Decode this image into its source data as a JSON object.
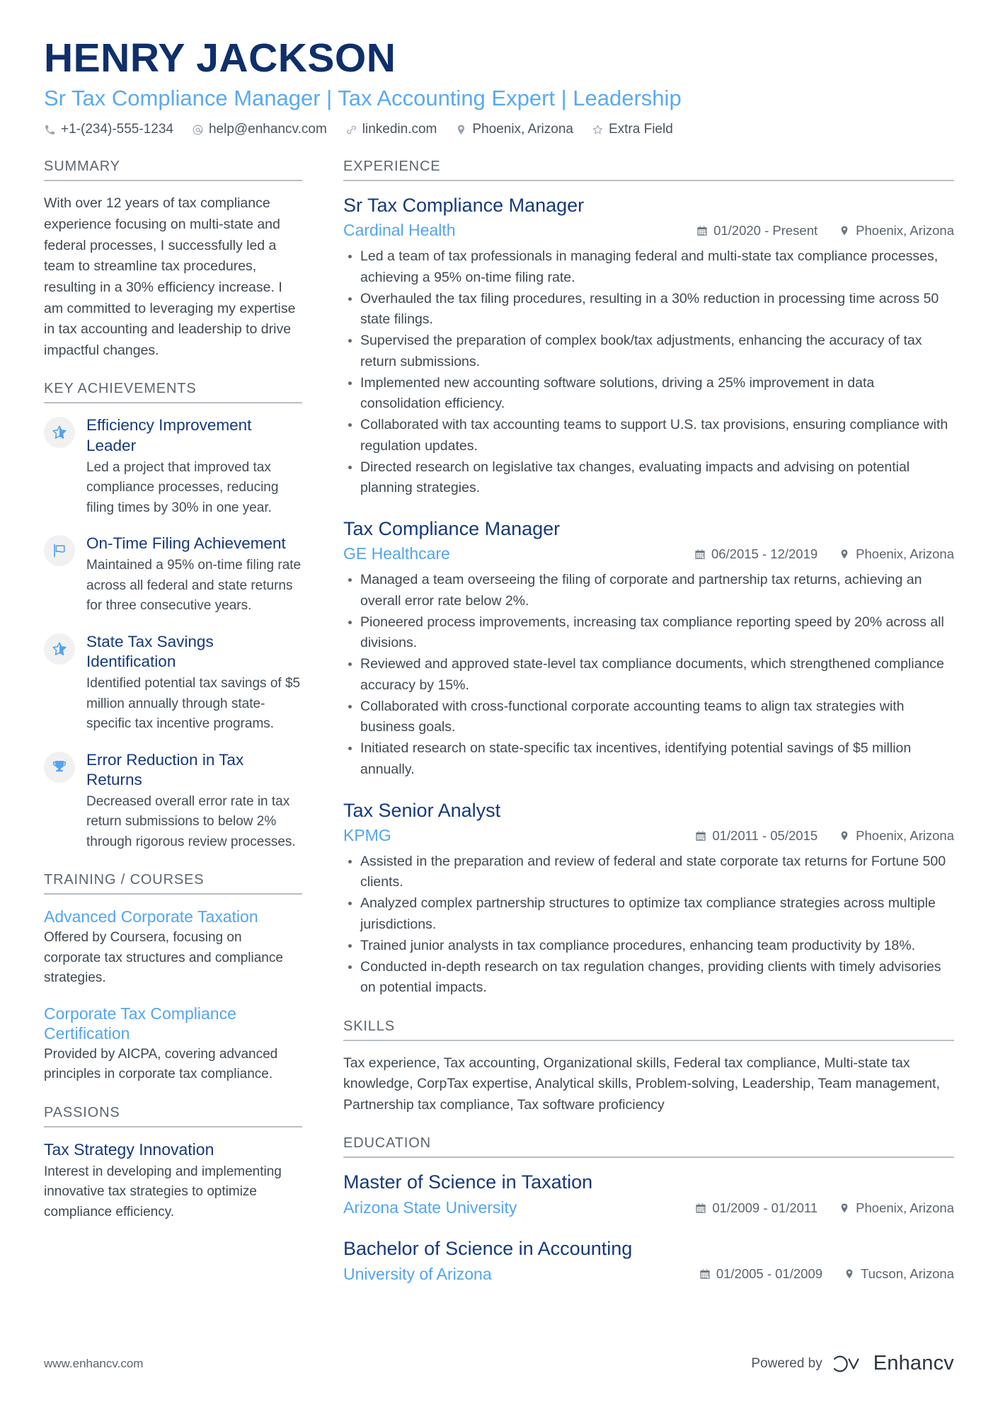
{
  "header": {
    "name": "HENRY JACKSON",
    "title": "Sr Tax Compliance Manager | Tax Accounting Expert | Leadership",
    "contacts": [
      {
        "icon": "phone-icon",
        "text": "+1-(234)-555-1234"
      },
      {
        "icon": "email-icon",
        "text": "help@enhancv.com"
      },
      {
        "icon": "link-icon",
        "text": "linkedin.com"
      },
      {
        "icon": "location-pin-icon",
        "text": "Phoenix, Arizona"
      },
      {
        "icon": "star-icon",
        "text": "Extra Field"
      }
    ]
  },
  "left": {
    "summary": {
      "heading": "SUMMARY",
      "text": "With over 12 years of tax compliance experience focusing on multi-state and federal processes, I successfully led a team to streamline tax procedures, resulting in a 30% efficiency increase. I am committed to leveraging my expertise in tax accounting and leadership to drive impactful changes."
    },
    "key_achievements": {
      "heading": "KEY ACHIEVEMENTS",
      "items": [
        {
          "icon": "half-star-icon",
          "title": "Efficiency Improvement Leader",
          "description": "Led a project that improved tax compliance processes, reducing filing times by 30% in one year."
        },
        {
          "icon": "flag-icon",
          "title": "On-Time Filing Achievement",
          "description": "Maintained a 95% on-time filing rate across all federal and state returns for three consecutive years."
        },
        {
          "icon": "half-star-icon",
          "title": "State Tax Savings Identification",
          "description": "Identified potential tax savings of $5 million annually through state-specific tax incentive programs."
        },
        {
          "icon": "trophy-icon",
          "title": "Error Reduction in Tax Returns",
          "description": "Decreased overall error rate in tax return submissions to below 2% through rigorous review processes."
        }
      ]
    },
    "training": {
      "heading": "TRAINING / COURSES",
      "items": [
        {
          "title": "Advanced Corporate Taxation",
          "description": "Offered by Coursera, focusing on corporate tax structures and compliance strategies."
        },
        {
          "title": "Corporate Tax Compliance Certification",
          "description": "Provided by AICPA, covering advanced principles in corporate tax compliance."
        }
      ]
    },
    "passions": {
      "heading": "PASSIONS",
      "items": [
        {
          "title": "Tax Strategy Innovation",
          "description": "Interest in developing and implementing innovative tax strategies to optimize compliance efficiency."
        }
      ]
    }
  },
  "right": {
    "experience": {
      "heading": "EXPERIENCE",
      "items": [
        {
          "title": "Sr Tax Compliance Manager",
          "organization": "Cardinal Health",
          "dates": "01/2020 - Present",
          "location": "Phoenix, Arizona",
          "bullets": [
            "Led a team of tax professionals in managing federal and multi-state tax compliance processes, achieving a 95% on-time filing rate.",
            "Overhauled the tax filing procedures, resulting in a 30% reduction in processing time across 50 state filings.",
            "Supervised the preparation of complex book/tax adjustments, enhancing the accuracy of tax return submissions.",
            "Implemented new accounting software solutions, driving a 25% improvement in data consolidation efficiency.",
            "Collaborated with tax accounting teams to support U.S. tax provisions, ensuring compliance with regulation updates.",
            "Directed research on legislative tax changes, evaluating impacts and advising on potential planning strategies."
          ]
        },
        {
          "title": "Tax Compliance Manager",
          "organization": "GE Healthcare",
          "dates": "06/2015 - 12/2019",
          "location": "Phoenix, Arizona",
          "bullets": [
            "Managed a team overseeing the filing of corporate and partnership tax returns, achieving an overall error rate below 2%.",
            "Pioneered process improvements, increasing tax compliance reporting speed by 20% across all divisions.",
            "Reviewed and approved state-level tax compliance documents, which strengthened compliance accuracy by 15%.",
            "Collaborated with cross-functional corporate accounting teams to align tax strategies with business goals.",
            "Initiated research on state-specific tax incentives, identifying potential savings of $5 million annually."
          ]
        },
        {
          "title": "Tax Senior Analyst",
          "organization": "KPMG",
          "dates": "01/2011 - 05/2015",
          "location": "Phoenix, Arizona",
          "bullets": [
            "Assisted in the preparation and review of federal and state corporate tax returns for Fortune 500 clients.",
            "Analyzed complex partnership structures to optimize tax compliance strategies across multiple jurisdictions.",
            "Trained junior analysts in tax compliance procedures, enhancing team productivity by 18%.",
            "Conducted in-depth research on tax regulation changes, providing clients with timely advisories on potential impacts."
          ]
        }
      ]
    },
    "skills": {
      "heading": "SKILLS",
      "text": "Tax experience, Tax accounting, Organizational skills, Federal tax compliance, Multi-state tax knowledge, CorpTax expertise, Analytical skills, Problem-solving, Leadership, Team management, Partnership tax compliance, Tax software proficiency"
    },
    "education": {
      "heading": "EDUCATION",
      "items": [
        {
          "title": "Master of Science in Taxation",
          "organization": "Arizona State University",
          "dates": "01/2009 - 01/2011",
          "location": "Phoenix, Arizona"
        },
        {
          "title": "Bachelor of Science in Accounting",
          "organization": "University of Arizona",
          "dates": "01/2005 - 01/2009",
          "location": "Tucson, Arizona"
        }
      ]
    }
  },
  "footer": {
    "url": "www.enhancv.com",
    "powered_by": "Powered by",
    "brand": "Enhancv"
  },
  "colors": {
    "name_navy": "#0f2f6b",
    "title_blue": "#5aa9f0",
    "heading_gray": "#5c666f",
    "entry_navy": "#15397c",
    "org_blue": "#54a4ef",
    "body_gray": "#3f4952"
  }
}
